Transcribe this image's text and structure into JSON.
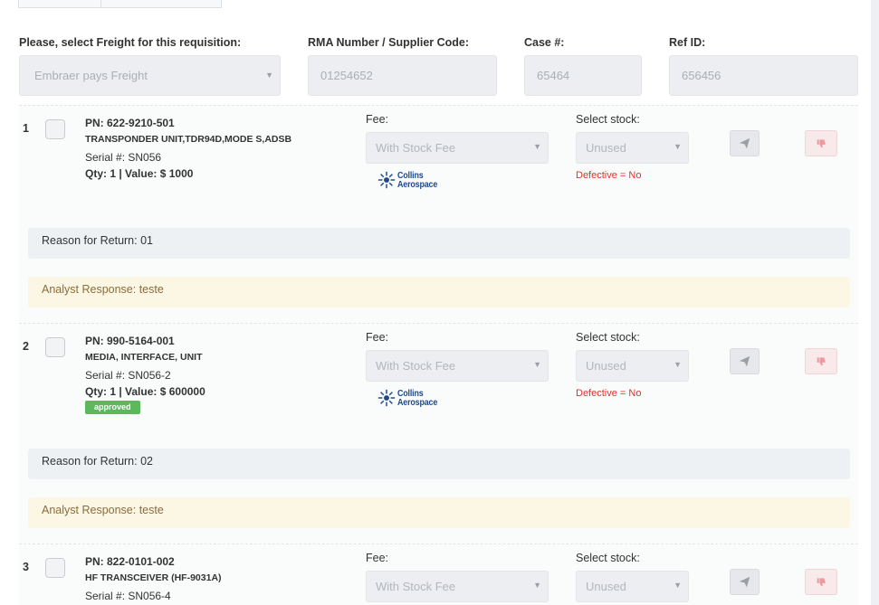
{
  "header": {
    "freight_label": "Please, select Freight for this requisition:",
    "freight_value": "Embraer pays Freight",
    "rma_label": "RMA Number / Supplier Code:",
    "rma_value": "01254652",
    "case_label": "Case #:",
    "case_value": "65464",
    "ref_label": "Ref ID:",
    "ref_value": "656456"
  },
  "common": {
    "fee_label": "Fee:",
    "stock_label": "Select stock:",
    "fee_value": "With Stock Fee",
    "stock_value": "Unused",
    "defective_text": "Defective = No",
    "logo_text_line1": "Collins",
    "logo_text_line2": "Aerospace",
    "colors": {
      "badge": "#5cb85c",
      "defective": "#d9332e",
      "analyst_bg": "#fcf6e4",
      "reason_bg": "#eef1f4"
    }
  },
  "items": [
    {
      "index": "1",
      "pn": "PN: 622-9210-501",
      "description": "TRANSPONDER UNIT,TDR94D,MODE S,ADSB",
      "serial": "Serial #: SN056",
      "qty": "Qty: 1 | Value: $ 1000",
      "badge": "",
      "reason": "Reason for Return: 01",
      "analyst": "Analyst Response: teste"
    },
    {
      "index": "2",
      "pn": "PN: 990-5164-001",
      "description": "MEDIA, INTERFACE, UNIT",
      "serial": "Serial #: SN056-2",
      "qty": "Qty: 1 | Value: $ 600000",
      "badge": "approved",
      "reason": "Reason for Return: 02",
      "analyst": "Analyst Response: teste"
    },
    {
      "index": "3",
      "pn": "PN: 822-0101-002",
      "description": "HF TRANSCEIVER (HF-9031A)",
      "serial": "Serial #: SN056-4"
    }
  ]
}
